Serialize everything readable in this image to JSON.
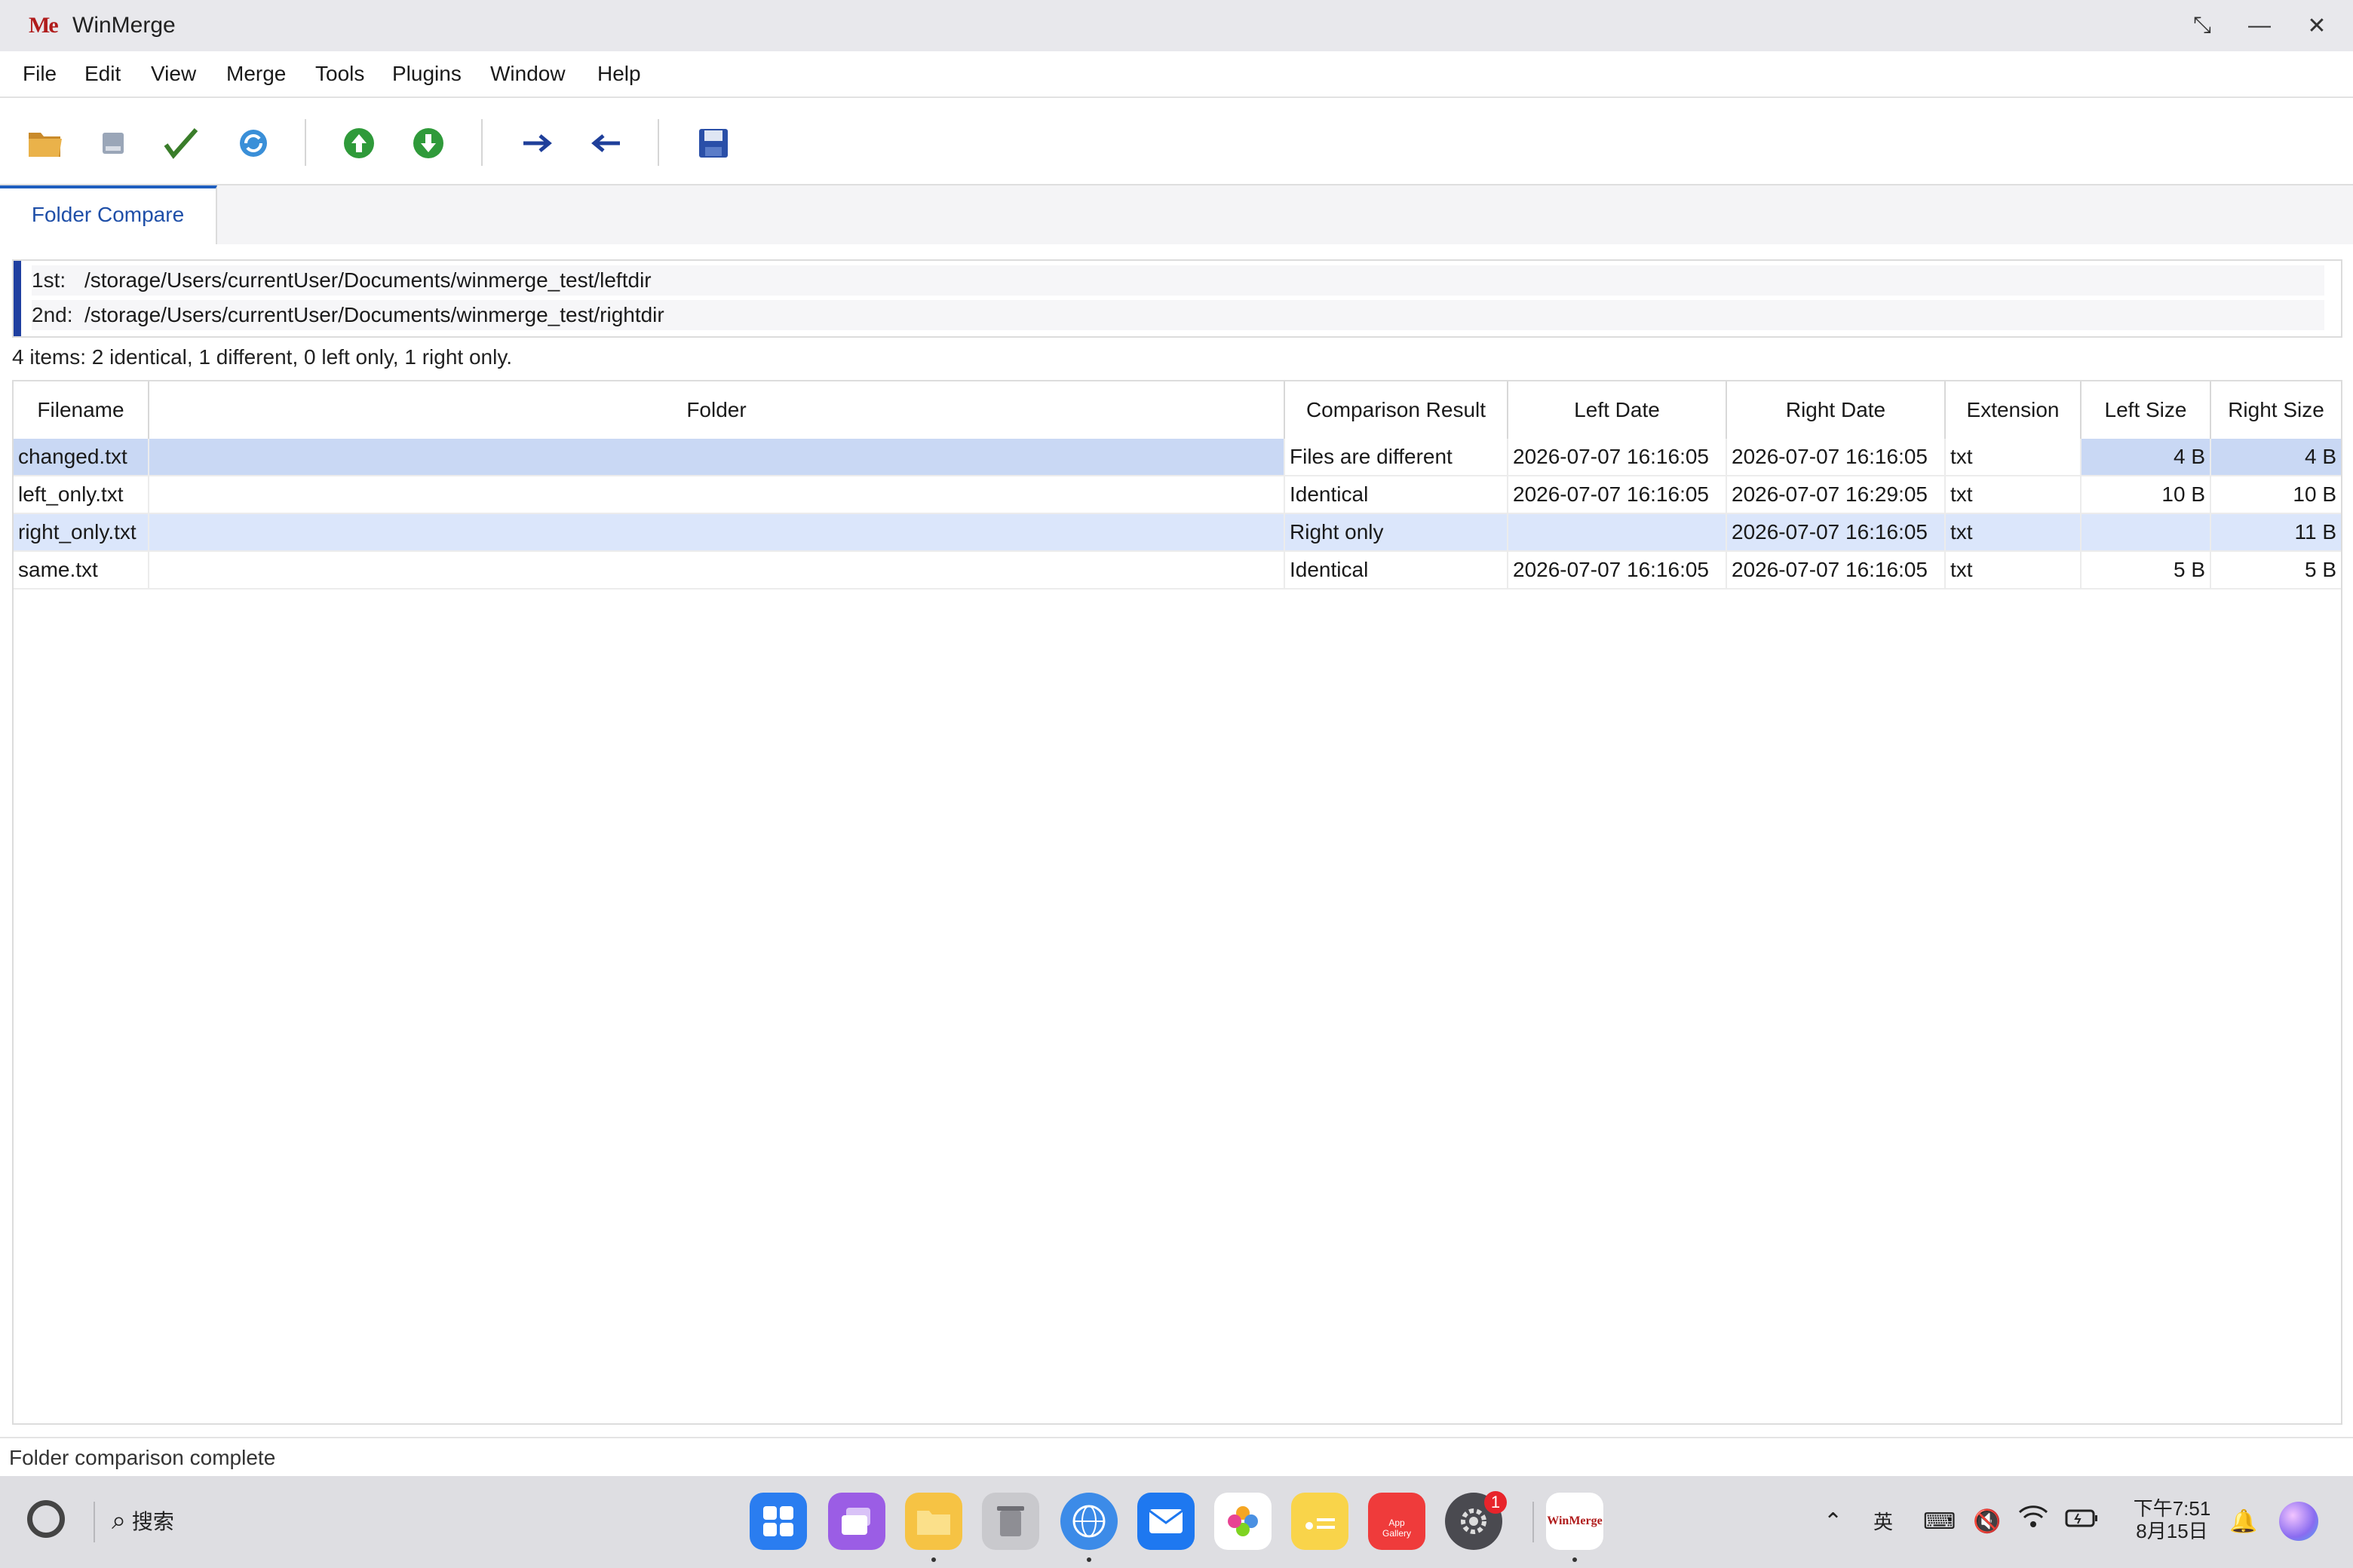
{
  "titlebar": {
    "logo_text": "Me",
    "title": "WinMerge",
    "restore_glyph": "⤡",
    "minimize_glyph": "—",
    "close_glyph": "✕"
  },
  "menu": [
    "File",
    "Edit",
    "View",
    "Merge",
    "Tools",
    "Plugins",
    "Window",
    "Help"
  ],
  "toolbar": {
    "buttons": [
      "open-folder-icon",
      "drive-icon",
      "checkmark-icon",
      "refresh-icon",
      "prev-diff-icon",
      "next-diff-icon",
      "copy-right-icon",
      "copy-left-icon",
      "save-icon"
    ]
  },
  "tabs": [
    {
      "label": "Folder Compare"
    }
  ],
  "paths": {
    "first_label": "1st:",
    "first_path": "/storage/Users/currentUser/Documents/winmerge_test/leftdir",
    "second_label": "2nd:",
    "second_path": "/storage/Users/currentUser/Documents/winmerge_test/rightdir"
  },
  "summary": "4 items: 2 identical, 1 different, 0 left only, 1 right only.",
  "table": {
    "columns": [
      "Filename",
      "Folder",
      "Comparison Result",
      "Left Date",
      "Right Date",
      "Extension",
      "Left Size",
      "Right Size"
    ],
    "rows": [
      {
        "filename": "changed.txt",
        "folder": "",
        "result": "Files are different",
        "left_date": "2026-07-07 16:16:05",
        "right_date": "2026-07-07 16:16:05",
        "ext": "txt",
        "left_size": "4 B",
        "right_size": "4 B",
        "state": "selected"
      },
      {
        "filename": "left_only.txt",
        "folder": "",
        "result": "Identical",
        "left_date": "2026-07-07 16:16:05",
        "right_date": "2026-07-07 16:29:05",
        "ext": "txt",
        "left_size": "10 B",
        "right_size": "10 B",
        "state": "normal"
      },
      {
        "filename": "right_only.txt",
        "folder": "",
        "result": "Right only",
        "left_date": "",
        "right_date": "2026-07-07 16:16:05",
        "ext": "txt",
        "left_size": "",
        "right_size": "11 B",
        "state": "highlight"
      },
      {
        "filename": "same.txt",
        "folder": "",
        "result": "Identical",
        "left_date": "2026-07-07 16:16:05",
        "right_date": "2026-07-07 16:16:05",
        "ext": "txt",
        "left_size": "5 B",
        "right_size": "5 B",
        "state": "normal"
      }
    ]
  },
  "status": "Folder comparison complete",
  "taskbar": {
    "search_label": "搜索",
    "apps": [
      "app-launcher-icon",
      "multitask-icon",
      "files-icon",
      "trash-icon",
      "browser-icon",
      "mail-icon",
      "photos-icon",
      "notes-icon",
      "app-gallery-icon",
      "settings-icon",
      "winmerge-icon"
    ],
    "app_gallery_label": "App Gallery",
    "settings_badge": "1",
    "winmerge_label": "WinMerge",
    "ime_label": "英",
    "time": "下午7:51",
    "date": "8月15日"
  },
  "colors": {
    "accent": "#1f5fbf",
    "selected_row": "#c9d8f4",
    "highlight_row": "#dbe6fb"
  }
}
